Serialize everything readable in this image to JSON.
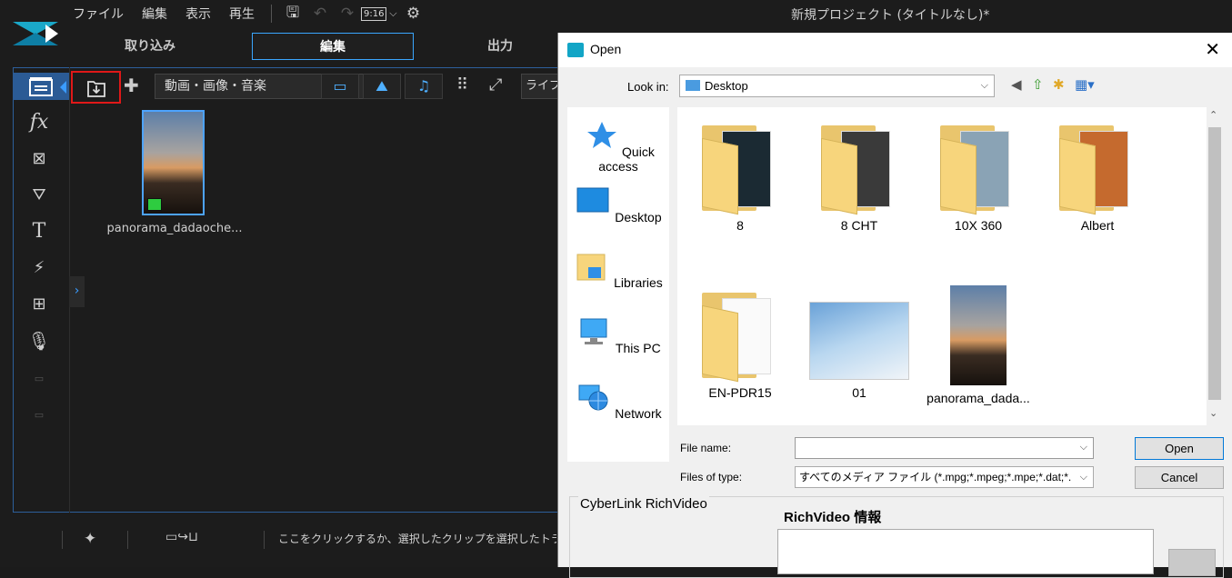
{
  "app": {
    "logo": "powerdirector-logo",
    "menus": [
      "ファイル",
      "編集",
      "表示",
      "再生"
    ],
    "aspect_ratio": "9:16",
    "title": "新規プロジェクト (タイトルなし)*"
  },
  "mode_tabs": [
    "取り込み",
    "編集",
    "出力"
  ],
  "library": {
    "media_filter": "動画・画像・音楽",
    "library_menu": "ライブラ",
    "clip_name": "panorama_dadaoche...",
    "hint_text": "ここをクリックするか、選択したクリップを選択したトラック"
  },
  "dialog": {
    "title": "Open",
    "look_in_label": "Look in:",
    "look_in_value": "Desktop",
    "places": [
      "Quick access",
      "Desktop",
      "Libraries",
      "This PC",
      "Network"
    ],
    "files": [
      "8",
      "8 CHT",
      "10X 360",
      "Albert",
      "EN-PDR15",
      "01",
      "panorama_dada..."
    ],
    "file_name_label": "File name:",
    "file_name_value": "",
    "files_of_type_label": "Files of type:",
    "files_of_type_value": "すべてのメディア ファイル (*.mpg;*.mpeg;*.mpe;*.dat;*.",
    "open_button": "Open",
    "cancel_button": "Cancel",
    "richvideo_group": "CyberLink RichVideo",
    "richvideo_info": "RichVideo 情報"
  },
  "colors": {
    "accent": "#3a9cff",
    "highlight_red": "#e01818",
    "rail_active": "#2b5b95"
  }
}
